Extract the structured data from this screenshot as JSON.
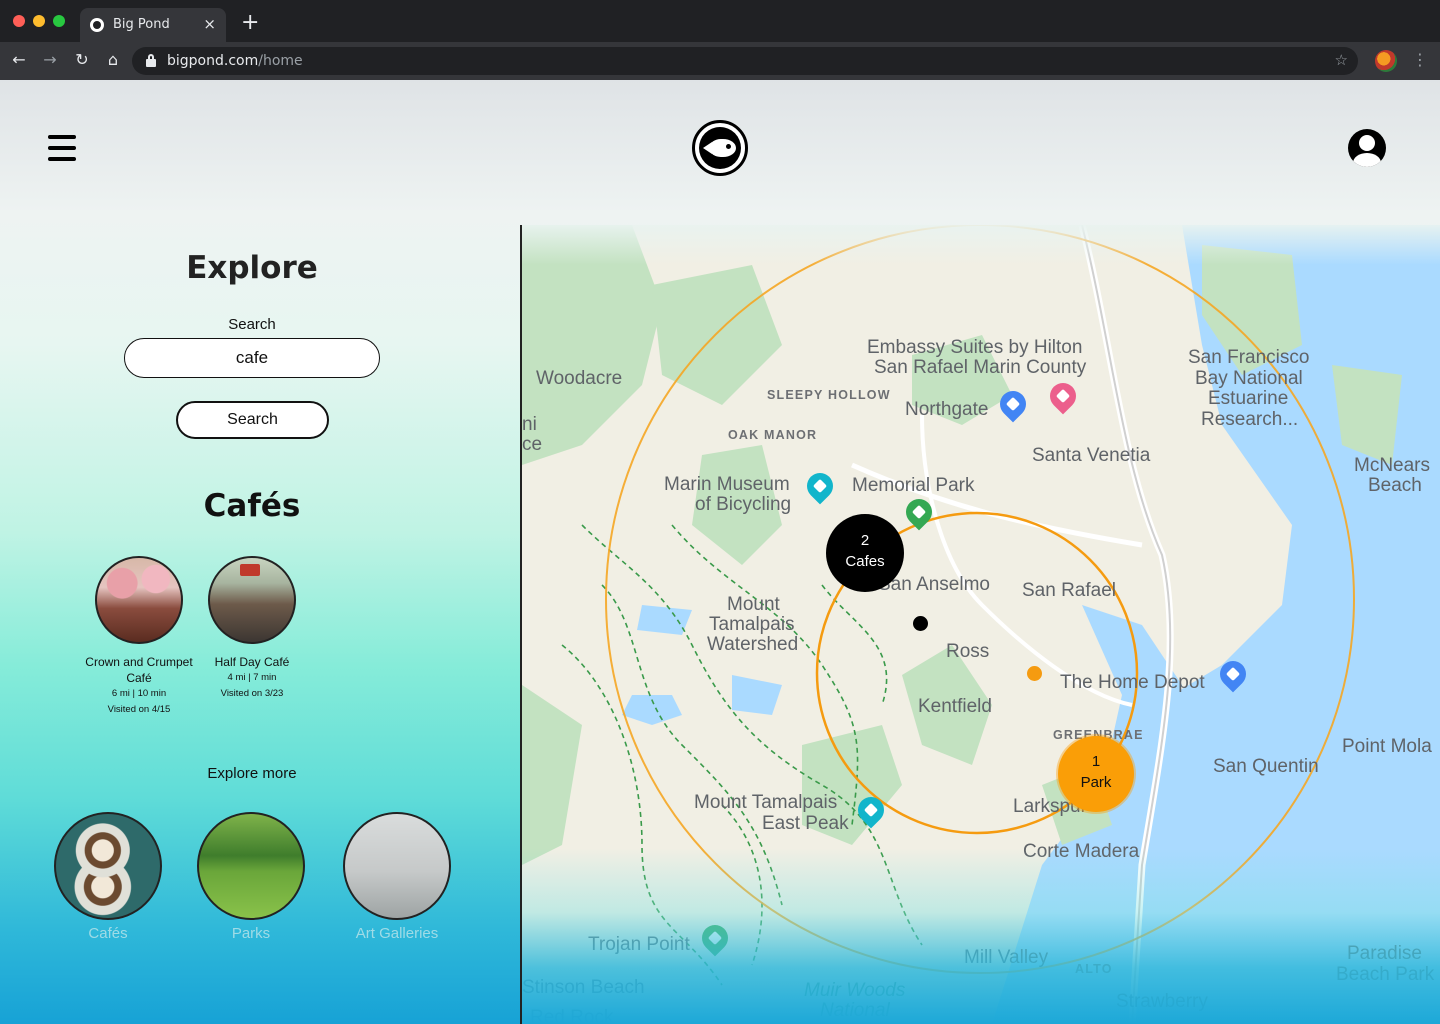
{
  "browser": {
    "tab_title": "Big Pond",
    "tab_close": "×",
    "new_tab": "+",
    "url_host": "bigpond.com",
    "url_path": "/home",
    "back": "←",
    "forward": "→",
    "reload": "↻",
    "home": "⌂",
    "star": "☆",
    "menu": "⋮"
  },
  "header": {
    "logo_icon": "fish-logo-icon",
    "menu_icon": "hamburger-icon",
    "account_icon": "account-icon"
  },
  "explore": {
    "title": "Explore",
    "search_label": "Search",
    "search_value": "cafe",
    "search_button": "Search"
  },
  "cafes": {
    "title": "Cafés",
    "items": [
      {
        "name": "Crown and Crumpet Café",
        "distance": "6 mi | 10 min",
        "visited": "Visited on 4/15"
      },
      {
        "name": "Half Day Café",
        "distance": "4 mi | 7 min",
        "visited": "Visited on 3/23"
      }
    ]
  },
  "explore_more": {
    "title": "Explore more",
    "categories": [
      {
        "label": "Cafés"
      },
      {
        "label": "Parks"
      },
      {
        "label": "Art Galleries"
      }
    ]
  },
  "map": {
    "clusters": [
      {
        "count": "2",
        "label": "Cafes",
        "color": "#000000"
      },
      {
        "count": "1",
        "label": "Park",
        "color": "#fa9e07"
      }
    ],
    "labels": {
      "embassy": "Embassy Suites by Hilton",
      "embassy2": "San Rafael Marin County",
      "sf_bay": "San Francisco",
      "sf_bay2": "Bay National",
      "sf_bay3": "Estuarine",
      "sf_bay4": "Research...",
      "woodacre": "Woodacre",
      "sleepy": "SLEEPY HOLLOW",
      "northgate": "Northgate",
      "oak": "OAK MANOR",
      "santa_venetia": "Santa Venetia",
      "mcnears": "McNears",
      "mcnears2": "Beach",
      "museum": "Marin Museum",
      "museum2": "of Bicycling",
      "memorial": "Memorial Park",
      "san_anselmo": "San Anselmo",
      "san_rafael": "San Rafael",
      "mount_tam": "Mount",
      "mount_tam2": "Tamalpais",
      "mount_tam3": "Watershed",
      "ross": "Ross",
      "home_depot": "The Home Depot",
      "kentfield": "Kentfield",
      "greenbrae": "GREENBRAE",
      "point_molate": "Point Mola",
      "san_quentin": "San Quentin",
      "east_peak": "Mount Tamalpais",
      "east_peak2": "East Peak",
      "larkspur": "Larkspur",
      "corte_madera": "Corte Madera",
      "trojan": "Trojan Point",
      "mill_valley": "Mill Valley",
      "alto": "ALTO",
      "paradise": "Paradise",
      "paradise2": "Beach Park",
      "stinson": "Stinson Beach",
      "muir": "Muir Woods",
      "muir2": "National",
      "red_rock": "Red Rock",
      "strawberry": "Strawberry",
      "edge_ni": "ni",
      "edge_ce": "ce"
    }
  }
}
